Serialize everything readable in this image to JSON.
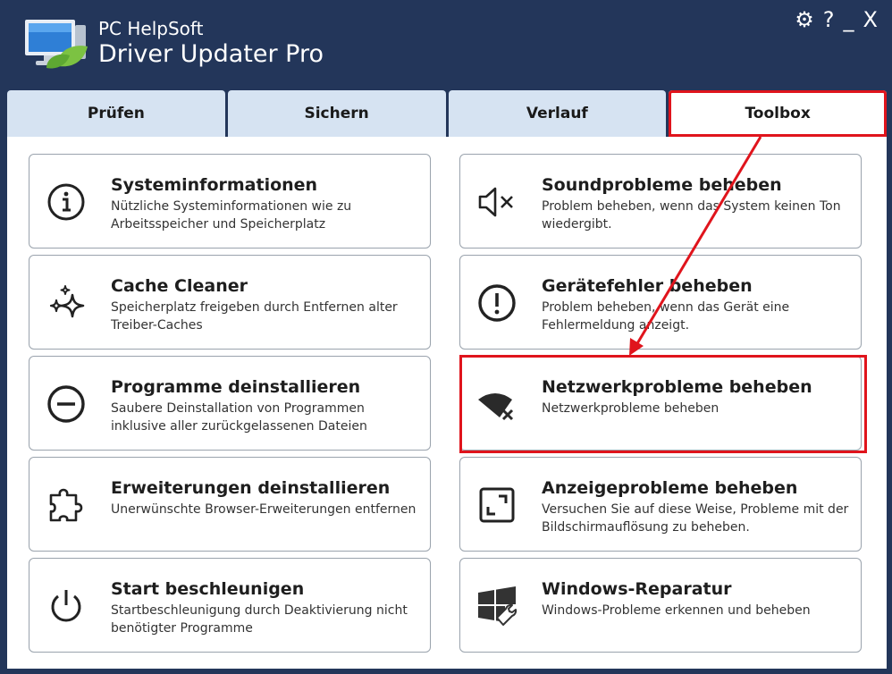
{
  "app": {
    "vendor": "PC HelpSoft",
    "product": "Driver Updater Pro"
  },
  "window_controls": {
    "settings": "⚙",
    "help": "?",
    "minimize": "_",
    "close": "X"
  },
  "tabs": [
    {
      "label": "Prüfen"
    },
    {
      "label": "Sichern"
    },
    {
      "label": "Verlauf"
    },
    {
      "label": "Toolbox"
    }
  ],
  "tools_left": [
    {
      "title": "Systeminformationen",
      "desc": "Nützliche Systeminformationen wie zu Arbeitsspeicher und Speicherplatz",
      "icon": "info-icon"
    },
    {
      "title": "Cache Cleaner",
      "desc": "Speicherplatz freigeben durch Entfernen alter Treiber-Caches",
      "icon": "sparkle-icon"
    },
    {
      "title": "Programme deinstallieren",
      "desc": "Saubere Deinstallation von Programmen inklusive aller zurückgelassenen Dateien",
      "icon": "minus-circle-icon"
    },
    {
      "title": "Erweiterungen deinstallieren",
      "desc": "Unerwünschte Browser-Erweiterungen entfernen",
      "icon": "puzzle-icon"
    },
    {
      "title": "Start beschleunigen",
      "desc": "Startbeschleunigung durch Deaktivierung nicht benötigter Programme",
      "icon": "power-icon"
    }
  ],
  "tools_right": [
    {
      "title": "Soundprobleme beheben",
      "desc": "Problem beheben, wenn das System keinen Ton wiedergibt.",
      "icon": "speaker-mute-icon"
    },
    {
      "title": "Gerätefehler beheben",
      "desc": "Problem beheben, wenn das Gerät eine Fehlermeldung anzeigt.",
      "icon": "exclamation-circle-icon"
    },
    {
      "title": "Netzwerkprobleme beheben",
      "desc": "Netzwerkprobleme beheben",
      "icon": "wifi-error-icon"
    },
    {
      "title": "Anzeigeprobleme beheben",
      "desc": "Versuchen Sie auf diese Weise, Probleme mit der Bildschirmauflösung zu beheben.",
      "icon": "resize-screen-icon"
    },
    {
      "title": "Windows-Reparatur",
      "desc": "Windows-Probleme erkennen und beheben",
      "icon": "windows-wrench-icon"
    }
  ],
  "colors": {
    "titlebar": "#23365a",
    "tab": "#d6e3f2",
    "highlight": "#e0141c"
  }
}
